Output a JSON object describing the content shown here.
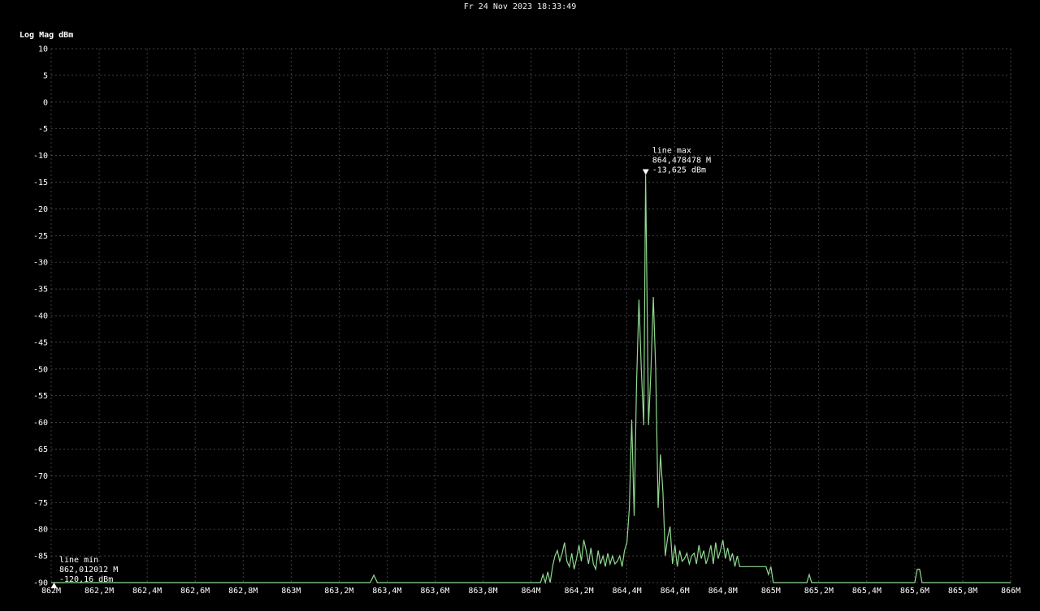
{
  "header": {
    "timestamp": "Fr 24 Nov 2023 18:33:49"
  },
  "chart_data": {
    "type": "line",
    "title": "",
    "ylabel": "Log Mag dBm",
    "xlabel": "",
    "xlim": [
      862.0,
      866.0
    ],
    "ylim": [
      -90,
      10
    ],
    "grid": true,
    "y_ticks": [
      10,
      5,
      0,
      -5,
      -10,
      -15,
      -20,
      -25,
      -30,
      -35,
      -40,
      -45,
      -50,
      -55,
      -60,
      -65,
      -70,
      -75,
      -80,
      -85,
      -90
    ],
    "y_tick_labels": [
      "10",
      "5",
      "0",
      "-5",
      "-10",
      "-15",
      "-20",
      "-25",
      "-30",
      "-35",
      "-40",
      "-45",
      "-50",
      "-55",
      "-60",
      "-65",
      "-70",
      "-75",
      "-80",
      "-85",
      "-90"
    ],
    "x_ticks": [
      862.0,
      862.2,
      862.4,
      862.6,
      862.8,
      863.0,
      863.2,
      863.4,
      863.6,
      863.8,
      864.0,
      864.2,
      864.4,
      864.6,
      864.8,
      865.0,
      865.2,
      865.4,
      865.6,
      865.8,
      866.0
    ],
    "x_tick_labels": [
      "862M",
      "862,2M",
      "862,4M",
      "862,6M",
      "862,8M",
      "863M",
      "863,2M",
      "863,4M",
      "863,6M",
      "863,8M",
      "864M",
      "864,2M",
      "864,4M",
      "864,6M",
      "864,8M",
      "865M",
      "865,2M",
      "865,4M",
      "865,6M",
      "865,8M",
      "866M"
    ],
    "line_color": "#8fd98f",
    "series": [
      {
        "x": [
          862.0,
          863.33,
          863.345,
          863.36,
          864.04,
          864.05,
          864.06,
          864.07,
          864.08,
          864.09,
          864.1,
          864.11,
          864.12,
          864.13,
          864.14,
          864.15,
          864.16,
          864.17,
          864.18,
          864.19,
          864.2,
          864.21,
          864.22,
          864.23,
          864.24,
          864.25,
          864.26,
          864.27,
          864.28,
          864.29,
          864.3,
          864.31,
          864.32,
          864.33,
          864.34,
          864.35,
          864.36,
          864.37,
          864.38,
          864.39,
          864.4,
          864.41,
          864.42,
          864.43,
          864.44,
          864.45,
          864.46,
          864.47,
          864.478,
          864.49,
          864.5,
          864.51,
          864.52,
          864.53,
          864.54,
          864.55,
          864.56,
          864.57,
          864.58,
          864.59,
          864.6,
          864.61,
          864.62,
          864.63,
          864.64,
          864.65,
          864.66,
          864.67,
          864.68,
          864.69,
          864.7,
          864.71,
          864.72,
          864.73,
          864.74,
          864.75,
          864.76,
          864.77,
          864.78,
          864.79,
          864.8,
          864.81,
          864.82,
          864.83,
          864.84,
          864.85,
          864.86,
          864.87,
          864.88,
          864.89,
          864.9,
          864.92,
          864.94,
          864.96,
          864.98,
          864.99,
          865.0,
          865.01,
          865.15,
          865.16,
          865.17,
          865.6,
          865.61,
          865.62,
          865.63,
          866.0
        ],
        "y": [
          -90,
          -90,
          -88.6,
          -90,
          -90,
          -88.5,
          -90,
          -88.0,
          -90,
          -87.0,
          -85.0,
          -84.0,
          -86.0,
          -84.5,
          -82.5,
          -86.0,
          -87.0,
          -84.5,
          -87.5,
          -85.5,
          -83.0,
          -86.0,
          -82.0,
          -84.0,
          -86.5,
          -83.5,
          -86.5,
          -87.5,
          -84.0,
          -86.5,
          -85.0,
          -87.0,
          -84.5,
          -86.5,
          -85.0,
          -86.5,
          -86.0,
          -85.0,
          -87.0,
          -84.0,
          -82.5,
          -76.0,
          -59.5,
          -77.5,
          -53.0,
          -37.0,
          -50.0,
          -60.5,
          -13.625,
          -60.5,
          -50.5,
          -36.5,
          -50.0,
          -76.0,
          -66.0,
          -73.0,
          -85.0,
          -81.5,
          -79.5,
          -86.5,
          -83.0,
          -87.0,
          -84.0,
          -86.0,
          -85.5,
          -84.5,
          -86.5,
          -85.0,
          -84.5,
          -86.5,
          -83.0,
          -85.5,
          -84.0,
          -86.5,
          -85.0,
          -83.0,
          -86.5,
          -82.5,
          -85.5,
          -84.0,
          -82.0,
          -85.5,
          -83.5,
          -86.0,
          -84.5,
          -87.0,
          -85.0,
          -87.0,
          -87.0,
          -87.0,
          -87.0,
          -87.0,
          -87.0,
          -87.0,
          -87.0,
          -88.5,
          -87.0,
          -90,
          -90,
          -88.5,
          -90,
          -90,
          -87.5,
          -87.5,
          -90,
          -90
        ]
      }
    ],
    "markers": [
      {
        "name": "line max",
        "freq": "864,478478 M",
        "level": "-13,625 dBm",
        "x": 864.478478,
        "y": -13.625
      },
      {
        "name": "line min",
        "freq": "862,012012 M",
        "level": "-120,16 dBm",
        "x": 862.012012,
        "y": -90
      }
    ]
  }
}
